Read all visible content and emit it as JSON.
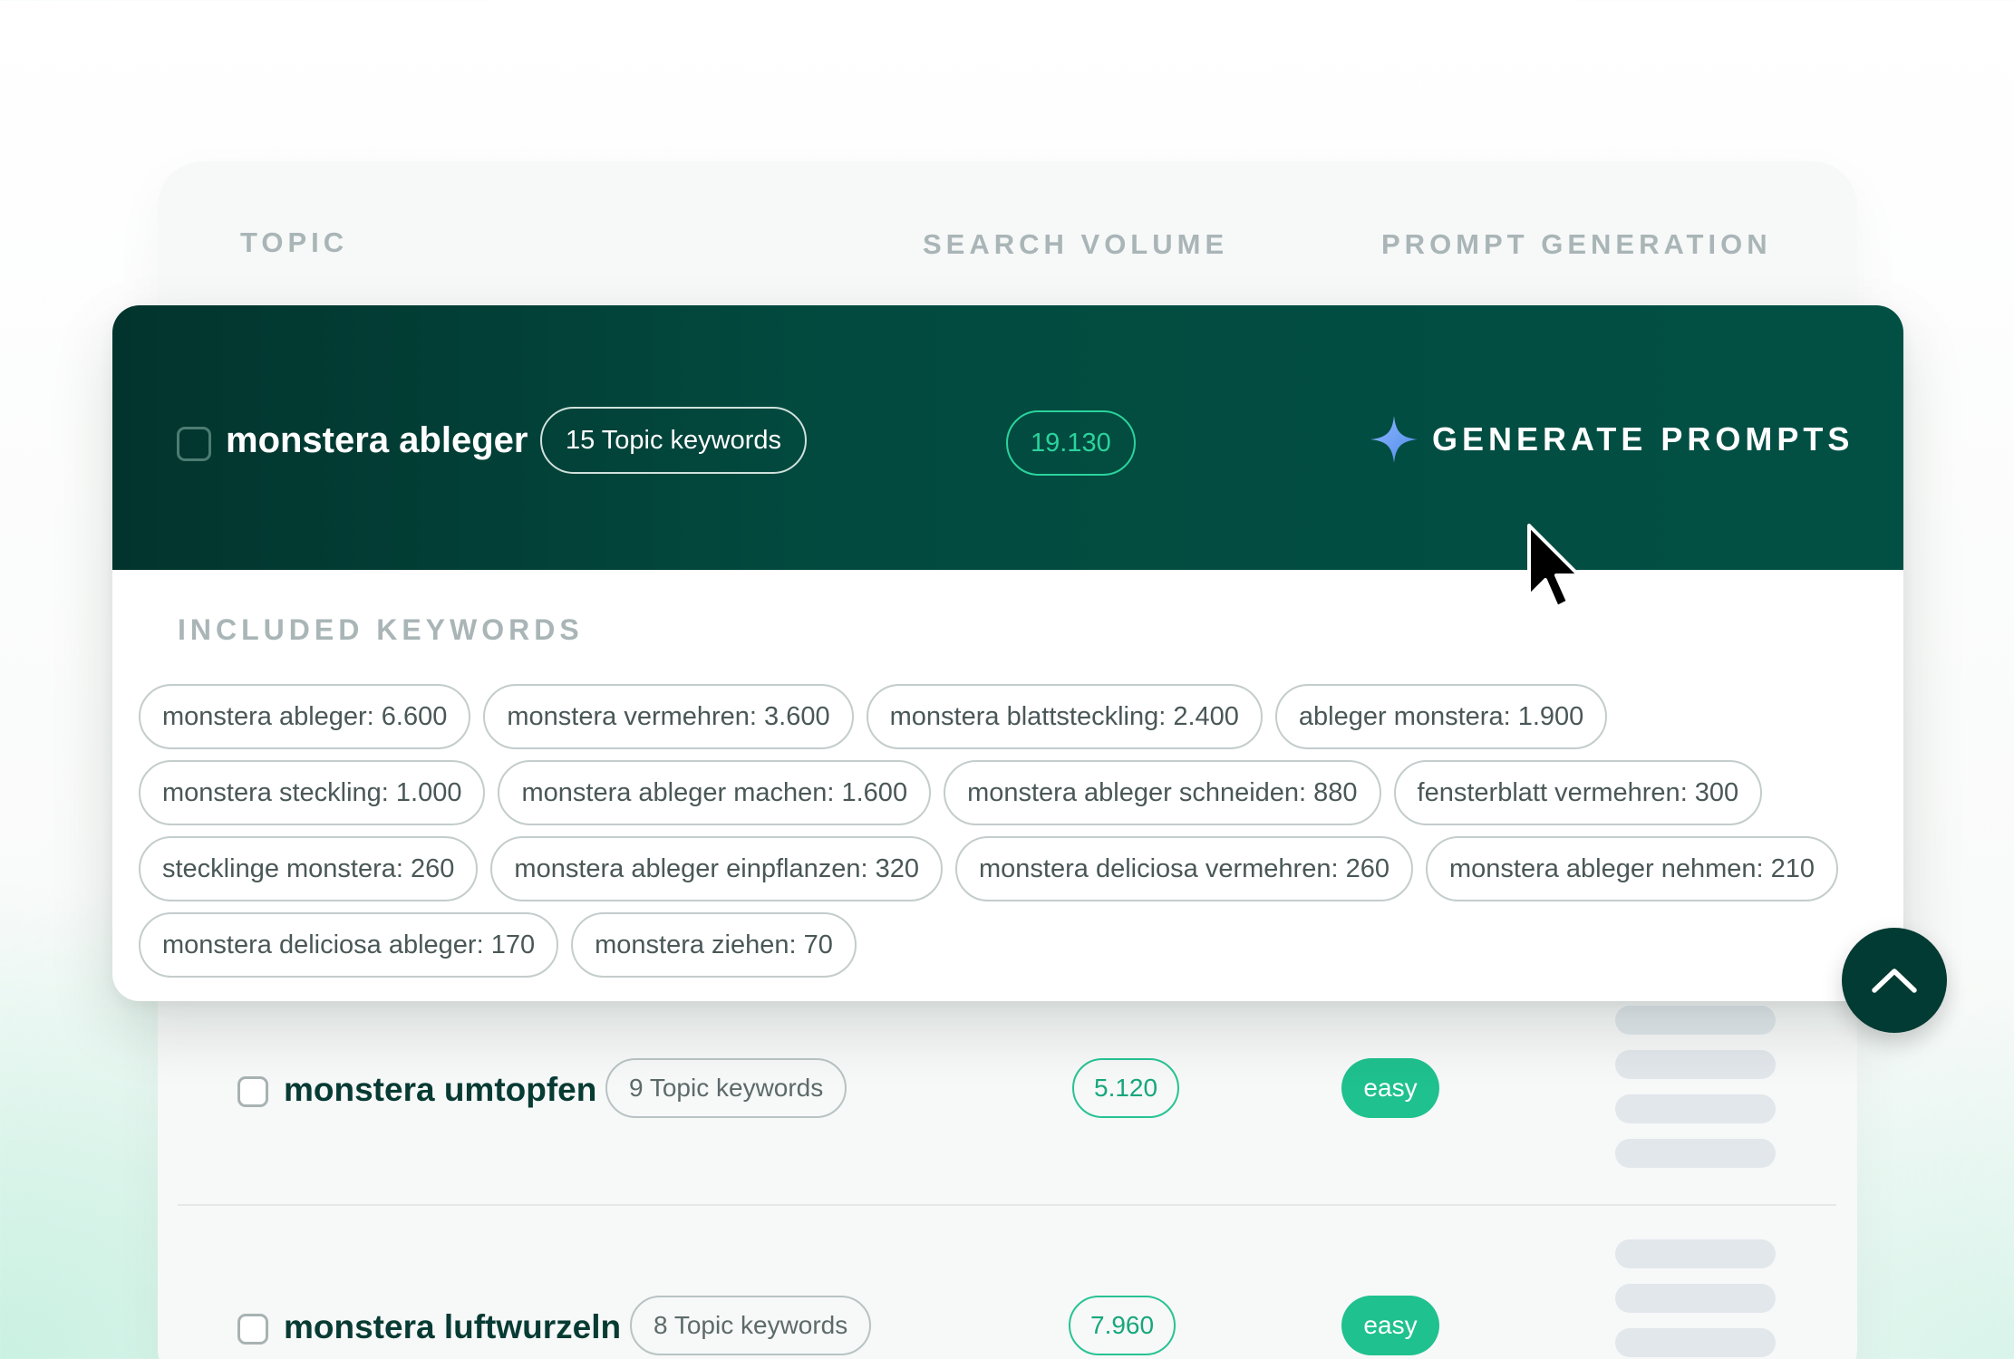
{
  "table": {
    "headers": {
      "topic": "TOPIC",
      "search_volume": "SEARCH VOLUME",
      "prompt_generation": "PROMPT GENERATION"
    }
  },
  "expanded_topic": {
    "title": "monstera ableger",
    "keyword_count": "15 Topic keywords",
    "search_volume": "19.130",
    "generate_button": "GENERATE PROMPTS",
    "included_label": "INCLUDED KEYWORDS",
    "keywords": [
      [
        "monstera ableger: 6.600",
        "monstera vermehren: 3.600",
        "monstera blattsteckling: 2.400",
        "ableger monstera: 1.900"
      ],
      [
        "monstera steckling: 1.000",
        "monstera ableger machen: 1.600",
        "monstera ableger schneiden: 880",
        "fensterblatt vermehren: 300"
      ],
      [
        "stecklinge monstera: 260",
        "monstera ableger einpflanzen: 320",
        "monstera deliciosa vermehren: 260",
        "monstera ableger nehmen: 210"
      ],
      [
        "monstera deliciosa ableger: 170",
        "monstera ziehen: 70"
      ]
    ]
  },
  "rows": [
    {
      "title": "monstera umtopfen",
      "keyword_count": "9 Topic keywords",
      "search_volume": "5.120",
      "difficulty": "easy"
    },
    {
      "title": "monstera luftwurzeln",
      "keyword_count": "8 Topic keywords",
      "search_volume": "7.960",
      "difficulty": "easy"
    }
  ],
  "colors": {
    "accent_dark": "#02342d",
    "accent_green": "#1fc18e",
    "sparkle_blue": "#6aa2f2"
  },
  "icons": [
    "sparkle-icon",
    "chevron-up-icon",
    "mouse-pointer-icon"
  ]
}
